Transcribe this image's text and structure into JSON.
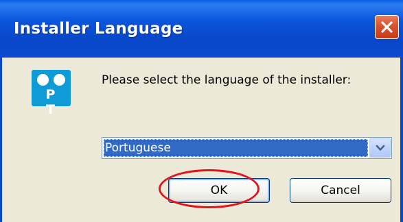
{
  "window": {
    "title": "Installer Language",
    "close_icon": "close-icon"
  },
  "app_icon": {
    "name": "pt-app-icon",
    "letters": "P T",
    "color": "#0E9BD6"
  },
  "prompt": "Please select the language of the installer:",
  "language_select": {
    "selected": "Portuguese",
    "arrow_icon": "chevron-down-icon"
  },
  "buttons": {
    "ok": "OK",
    "cancel": "Cancel"
  },
  "annotation": {
    "type": "red-ellipse-highlight",
    "color": "#E0141C"
  },
  "colors": {
    "titlebar": "#0A4BD2",
    "dialog_bg": "#ECE9D8",
    "selection": "#316AC5"
  }
}
